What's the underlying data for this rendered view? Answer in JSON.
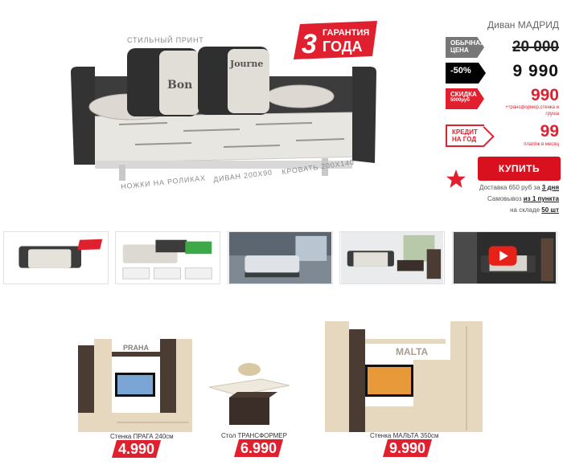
{
  "hero": {
    "badge_top": "ГАРАНТИЯ",
    "badge_num": "3",
    "badge_word": "ГОДА",
    "label_print": "СТИЛЬНЫЙ ПРИНТ",
    "label_wheels": "НОЖКИ НА РОЛИКАХ",
    "label_sofa": "ДИВАН 200х90",
    "label_bed": "КРОВАТЬ 200х140"
  },
  "panel": {
    "product_name": "Диван МАДРИД",
    "regular_tag_1": "ОБЫЧНАЯ",
    "regular_tag_2": "ЦЕНА",
    "regular_price": "20 000",
    "sale_tag": "-50%",
    "sale_price": "9 990",
    "discount_tag_1": "СКИДКА",
    "discount_tag_2": "5000руб",
    "discount_value": "990",
    "discount_note_1": "+трансформер,стенка и",
    "discount_note_2": "груша",
    "credit_tag_1": "КРЕДИТ",
    "credit_tag_2": "НА ГОД",
    "credit_value": "99",
    "credit_note": "платёж в месяц",
    "buy_label": "КУПИТЬ",
    "delivery_text": "Доставка 650 руб за ",
    "delivery_days": "3 дня",
    "pickup_text": "Самовывоз ",
    "pickup_point": "из 1 пункта",
    "stock_text": "на складе ",
    "stock_count": "50 шт"
  },
  "thumbnails": [
    {
      "label": "Диван МАДРИД — фото 1"
    },
    {
      "label": "Диван МАДРИД — фото 2"
    },
    {
      "label": "Диван МАДРИД — фото 3"
    },
    {
      "label": "Диван МАДРИД — фото 4"
    },
    {
      "label": "Диван МАДРИД — видео"
    }
  ],
  "products": [
    {
      "name": "Стенка ПРАГА 240см",
      "price": "4.990",
      "shelf_word": "PRAHA"
    },
    {
      "name": "Стол ТРАНСФОРМЕР",
      "price": "6.990"
    },
    {
      "name": "Стенка МАЛЬТА 350см",
      "price": "9.990",
      "shelf_word": "MALTA"
    }
  ],
  "colors": {
    "accent": "#e0202e",
    "button": "#d9101e",
    "dark_fabric": "#3c3c3c",
    "print_fabric": "#e8e6e1",
    "wood_light": "#e6d7bf",
    "wood_dark": "#4a3b33"
  }
}
